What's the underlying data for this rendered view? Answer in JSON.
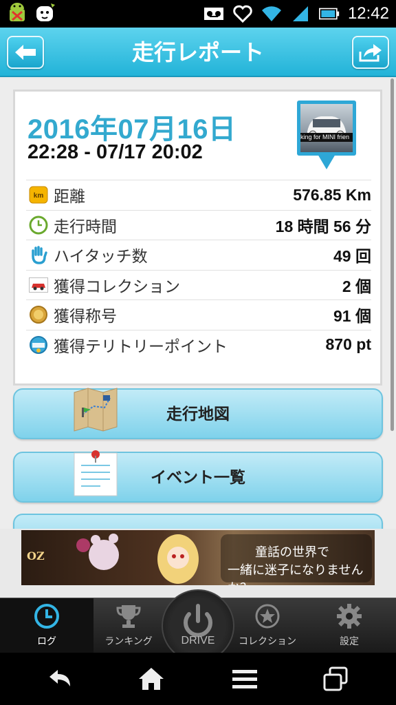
{
  "status_bar": {
    "time": "12:42",
    "icons": [
      "android-notification-icon",
      "dog-notification-icon",
      "voicemail-icon",
      "heart-icon",
      "wifi-icon",
      "signal-icon",
      "battery-icon"
    ]
  },
  "header": {
    "title": "走行レポート",
    "back_icon": "back-arrow-icon",
    "share_icon": "share-icon"
  },
  "report": {
    "date": "2016年07月16日",
    "time_range": "22:28 - 07/17 20:02",
    "car_photo_caption": "king for MINI frien",
    "stats": [
      {
        "icon": "km-icon",
        "label": "距離",
        "value": "576.85 Km"
      },
      {
        "icon": "clock-icon",
        "label": "走行時間",
        "value": "18 時間 56 分"
      },
      {
        "icon": "hand-icon",
        "label": "ハイタッチ数",
        "value": "49 回"
      },
      {
        "icon": "car-collection-icon",
        "label": "獲得コレクション",
        "value": "2 個"
      },
      {
        "icon": "medal-icon",
        "label": "獲得称号",
        "value": "91 個"
      },
      {
        "icon": "spot-icon",
        "label": "獲得テリトリーポイント",
        "value": "870 pt"
      }
    ]
  },
  "menu": {
    "map_label": "走行地図",
    "event_label": "イベント一覧"
  },
  "banner": {
    "line1": "童話の世界で",
    "line2": "一緒に迷子になりませんか？",
    "logo": "OZ"
  },
  "tabs": [
    {
      "label": "ログ",
      "icon": "clock-icon",
      "active": true
    },
    {
      "label": "ランキング",
      "icon": "trophy-icon"
    },
    {
      "label": "DRIVE",
      "icon": "power-icon"
    },
    {
      "label": "コレクション",
      "icon": "star-icon"
    },
    {
      "label": "設定",
      "icon": "gear-icon"
    }
  ],
  "colors": {
    "accent": "#33a9cf",
    "header": "#22b3d8",
    "button": "#8fd7ee"
  }
}
